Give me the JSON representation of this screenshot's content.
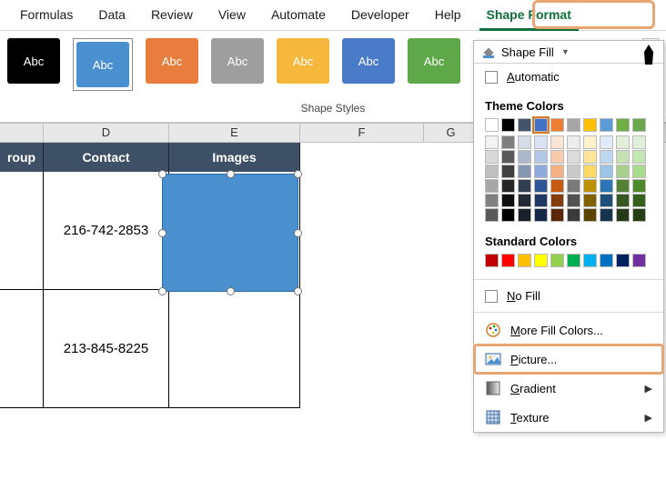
{
  "tabs": [
    "Formulas",
    "Data",
    "Review",
    "View",
    "Automate",
    "Developer",
    "Help",
    "Shape Format"
  ],
  "active_tab": "Shape Format",
  "gallery": {
    "swatch_label": "Abc",
    "group_label": "Shape Styles"
  },
  "columns": {
    "c_partial": "roup",
    "d": "D",
    "e": "E",
    "f": "F",
    "g": "G"
  },
  "headers": {
    "contact": "Contact",
    "images": "Images"
  },
  "rows": [
    {
      "contact": "216-742-2853"
    },
    {
      "contact": "213-845-8225"
    }
  ],
  "dropdown": {
    "button_label": "Shape Fill",
    "automatic": "Automatic",
    "theme_title": "Theme Colors",
    "standard_title": "Standard Colors",
    "no_fill": "No Fill",
    "more_colors": "More Fill Colors...",
    "picture": "Picture...",
    "gradient": "Gradient",
    "texture": "Texture",
    "theme_row": [
      "#ffffff",
      "#000000",
      "#44546a",
      "#4472c4",
      "#ed7d31",
      "#a5a5a5",
      "#ffc000",
      "#5b9bd5",
      "#70ad47",
      "#6aa84f"
    ],
    "theme_tints": [
      [
        "#f2f2f2",
        "#d9d9d9",
        "#bfbfbf",
        "#a6a6a6",
        "#808080",
        "#595959"
      ],
      [
        "#7f7f7f",
        "#595959",
        "#404040",
        "#262626",
        "#0d0d0d",
        "#000000"
      ],
      [
        "#d6dce5",
        "#adb9ca",
        "#8497b0",
        "#333f50",
        "#222a35",
        "#1a202a"
      ],
      [
        "#d9e2f3",
        "#b4c7e7",
        "#8faadc",
        "#2f5597",
        "#203864",
        "#162849"
      ],
      [
        "#fbe5d6",
        "#f7cbac",
        "#f4b183",
        "#c55a11",
        "#843c0c",
        "#5a2808"
      ],
      [
        "#ededed",
        "#dbdbdb",
        "#c9c9c9",
        "#7b7b7b",
        "#525252",
        "#3a3a3a"
      ],
      [
        "#fff2cc",
        "#ffe699",
        "#ffd966",
        "#bf9000",
        "#806000",
        "#5a4400"
      ],
      [
        "#deebf7",
        "#bdd7ee",
        "#9dc3e6",
        "#2e75b6",
        "#1f4e79",
        "#153450"
      ],
      [
        "#e2f0d9",
        "#c5e0b4",
        "#a9d18e",
        "#548235",
        "#385723",
        "#263a18"
      ],
      [
        "#dff0d8",
        "#c3e6b3",
        "#a7dc8e",
        "#4f8a2a",
        "#35601c",
        "#253f14"
      ]
    ],
    "standard_row": [
      "#c00000",
      "#ff0000",
      "#ffc000",
      "#ffff00",
      "#92d050",
      "#00b050",
      "#00b0f0",
      "#0070c0",
      "#002060",
      "#7030a0"
    ]
  }
}
